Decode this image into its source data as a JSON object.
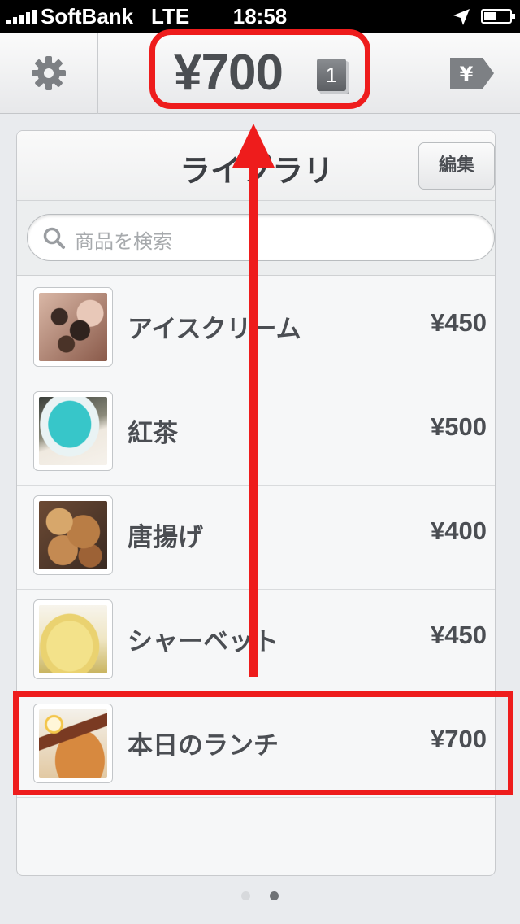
{
  "status_bar": {
    "carrier": "SoftBank",
    "network": "LTE",
    "time": "18:58"
  },
  "toolbar": {
    "total": "¥700",
    "count_badge": "1",
    "settings_icon": "gear-icon",
    "checkout_icon": "yen-tag-icon"
  },
  "library": {
    "title": "ライブラリ",
    "edit_label": "編集",
    "search_placeholder": "商品を検索",
    "items": [
      {
        "name": "アイスクリーム",
        "price": "¥450",
        "image": "ice-cream-photo",
        "tint": "#8a5a4a"
      },
      {
        "name": "紅茶",
        "price": "¥500",
        "image": "tea-photo",
        "tint": "#4fc2c6"
      },
      {
        "name": "唐揚げ",
        "price": "¥400",
        "image": "karaage-photo",
        "tint": "#a86a3c"
      },
      {
        "name": "シャーベット",
        "price": "¥450",
        "image": "sherbet-photo",
        "tint": "#e7d47a"
      },
      {
        "name": "本日のランチ",
        "price": "¥700",
        "image": "lunch-photo",
        "tint": "#c8843e"
      }
    ]
  },
  "page_indicator": {
    "pages": 2,
    "current": 2
  },
  "colors": {
    "highlight": "#ee1c1c",
    "text": "#4b4e53"
  }
}
